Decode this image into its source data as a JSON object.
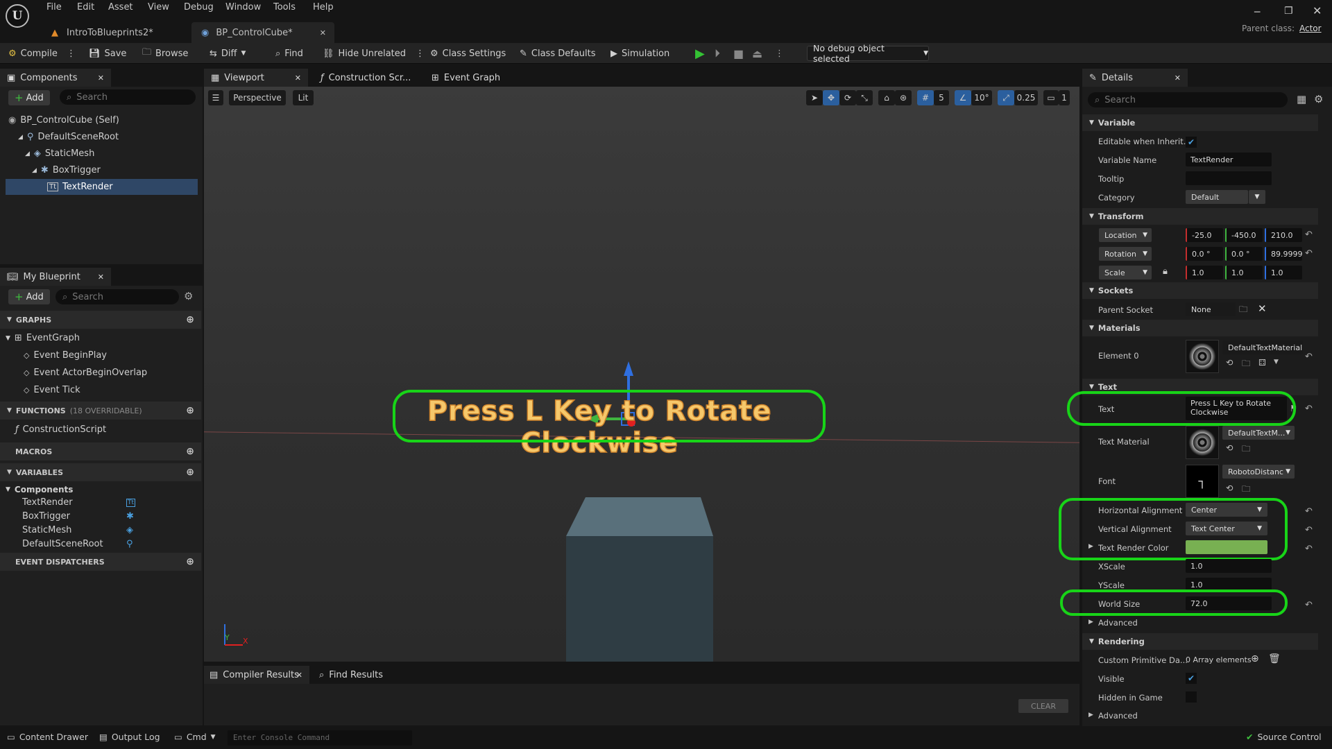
{
  "menu": [
    "File",
    "Edit",
    "Asset",
    "View",
    "Debug",
    "Window",
    "Tools",
    "Help"
  ],
  "tabs": [
    {
      "label": "IntroToBlueprints2*"
    },
    {
      "label": "BP_ControlCube*"
    }
  ],
  "parent_class": {
    "label": "Parent class:",
    "value": "Actor"
  },
  "toolbar": {
    "compile": "Compile",
    "save": "Save",
    "browse": "Browse",
    "diff": "Diff",
    "find": "Find",
    "hide_unrelated": "Hide Unrelated",
    "class_settings": "Class Settings",
    "class_defaults": "Class Defaults",
    "simulation": "Simulation",
    "debug_object": "No debug object selected"
  },
  "components": {
    "tab": "Components",
    "add": "Add",
    "search_placeholder": "Search",
    "tree": [
      "BP_ControlCube (Self)",
      "DefaultSceneRoot",
      "StaticMesh",
      "BoxTrigger",
      "TextRender"
    ]
  },
  "my_blueprint": {
    "tab": "My Blueprint",
    "add": "Add",
    "search_placeholder": "Search",
    "graphs_header": "GRAPHS",
    "event_graph": "EventGraph",
    "events": [
      "Event BeginPlay",
      "Event ActorBeginOverlap",
      "Event Tick"
    ],
    "functions_header": "FUNCTIONS",
    "functions_count": "(18 OVERRIDABLE)",
    "construction_script": "ConstructionScript",
    "macros_header": "MACROS",
    "variables_header": "VARIABLES",
    "components_header": "Components",
    "variables": [
      "TextRender",
      "BoxTrigger",
      "StaticMesh",
      "DefaultSceneRoot"
    ],
    "dispatchers_header": "EVENT DISPATCHERS"
  },
  "editor_tabs": {
    "viewport": "Viewport",
    "construction": "Construction Scr...",
    "event_graph": "Event Graph"
  },
  "viewport": {
    "perspective": "Perspective",
    "lit": "Lit",
    "grid_snap": "5",
    "rot_snap": "10°",
    "scale_snap": "0.25",
    "camera_speed": "1",
    "text_render": "Press L Key to Rotate Clockwise",
    "axis_y": "Y",
    "axis_x": "X"
  },
  "bottom": {
    "compiler_results": "Compiler Results",
    "find_results": "Find Results",
    "clear": "CLEAR"
  },
  "status": {
    "content_drawer": "Content Drawer",
    "output_log": "Output Log",
    "cmd": "Cmd",
    "console_placeholder": "Enter Console Command",
    "source_control": "Source Control"
  },
  "details": {
    "tab": "Details",
    "search_placeholder": "Search",
    "variable_header": "Variable",
    "editable_label": "Editable when Inherit...",
    "variable_name_label": "Variable Name",
    "variable_name": "TextRender",
    "tooltip_label": "Tooltip",
    "category_label": "Category",
    "category": "Default",
    "transform_header": "Transform",
    "location_label": "Location",
    "location": [
      "-25.0",
      "-450.0",
      "210.0"
    ],
    "rotation_label": "Rotation",
    "rotation": [
      "0.0 °",
      "0.0 °",
      "89.9999"
    ],
    "scale_label": "Scale",
    "scale": [
      "1.0",
      "1.0",
      "1.0"
    ],
    "sockets_header": "Sockets",
    "parent_socket_label": "Parent Socket",
    "parent_socket": "None",
    "materials_header": "Materials",
    "element0_label": "Element 0",
    "element0": "DefaultTextMaterial",
    "text_header": "Text",
    "text_label": "Text",
    "text_value": "Press L Key to Rotate Clockwise",
    "text_material_label": "Text Material",
    "text_material": "DefaultTextM...",
    "font_label": "Font",
    "font": "RobotoDistanc",
    "h_align_label": "Horizontal Alignment",
    "h_align": "Center",
    "v_align_label": "Vertical Alignment",
    "v_align": "Text Center",
    "color_label": "Text Render Color",
    "color_value": "#78b052",
    "xscale_label": "XScale",
    "xscale": "1.0",
    "yscale_label": "YScale",
    "yscale": "1.0",
    "world_size_label": "World Size",
    "world_size": "72.0",
    "advanced": "Advanced",
    "rendering_header": "Rendering",
    "custom_primitive_label": "Custom Primitive Da...",
    "custom_primitive": "0 Array elements",
    "visible_label": "Visible",
    "hidden_label": "Hidden in Game",
    "advanced2": "Advanced"
  },
  "colors": {
    "highlight": "#18d418",
    "play": "#34c234",
    "accent": "#1e88e5"
  }
}
